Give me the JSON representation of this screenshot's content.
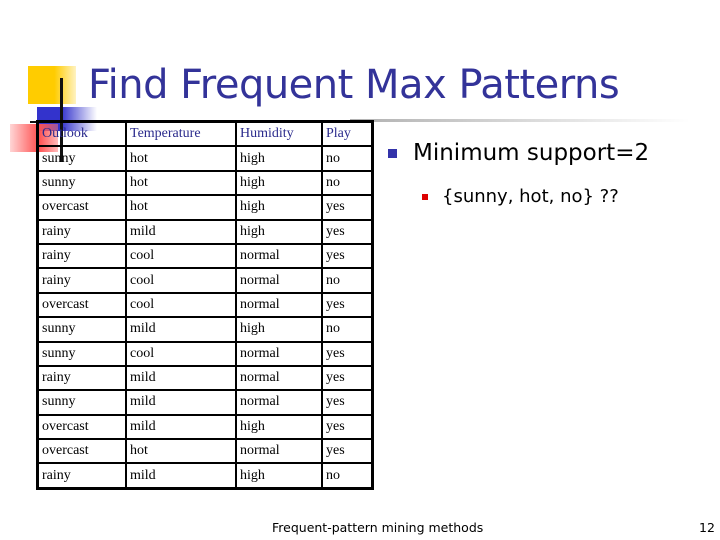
{
  "slide": {
    "title": "Find Frequent Max Patterns",
    "footer": "Frequent-pattern mining methods",
    "page_number": "12"
  },
  "table": {
    "headers": [
      "Outlook",
      "Temperature",
      "Humidity",
      "Play"
    ],
    "rows": [
      [
        "sunny",
        "hot",
        "high",
        "no"
      ],
      [
        "sunny",
        "hot",
        "high",
        "no"
      ],
      [
        "overcast",
        "hot",
        "high",
        "yes"
      ],
      [
        "rainy",
        "mild",
        "high",
        "yes"
      ],
      [
        "rainy",
        "cool",
        "normal",
        "yes"
      ],
      [
        "rainy",
        "cool",
        "normal",
        "no"
      ],
      [
        "overcast",
        "cool",
        "normal",
        "yes"
      ],
      [
        "sunny",
        "mild",
        "high",
        "no"
      ],
      [
        "sunny",
        "cool",
        "normal",
        "yes"
      ],
      [
        "rainy",
        "mild",
        "normal",
        "yes"
      ],
      [
        "sunny",
        "mild",
        "normal",
        "yes"
      ],
      [
        "overcast",
        "mild",
        "high",
        "yes"
      ],
      [
        "overcast",
        "hot",
        "normal",
        "yes"
      ],
      [
        "rainy",
        "mild",
        "high",
        "no"
      ]
    ]
  },
  "bullets": {
    "level1": "Minimum support=2",
    "level2": "{sunny, hot, no} ??"
  },
  "colors": {
    "title": "#333399",
    "bullet1": "#3333aa",
    "bullet2": "#dd0000",
    "header_text": "#2a2a8c"
  }
}
